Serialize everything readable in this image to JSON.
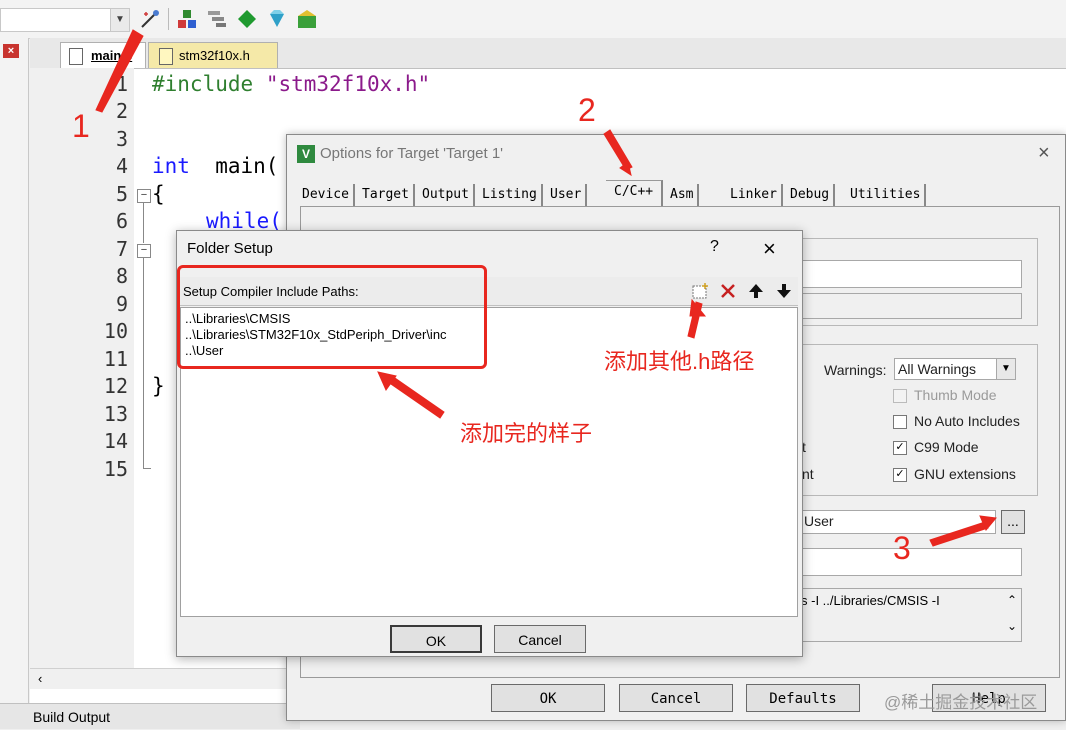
{
  "editor": {
    "tabs": [
      {
        "label": "main.c",
        "active": true
      },
      {
        "label": "stm32f10x.h",
        "active": false
      }
    ],
    "line_numbers": [
      "1",
      "2",
      "3",
      "4",
      "5",
      "6",
      "7",
      "8",
      "9",
      "10",
      "11",
      "12",
      "13",
      "14",
      "15"
    ],
    "code": {
      "line1_directive": "#include",
      "line1_string": "\"stm32f10x.h\"",
      "line4_keyword": "int",
      "line4_rest": "  main(",
      "line5": "{",
      "line6_keyword": "while(",
      "line12": "}"
    },
    "build_output_label": "Build Output",
    "close_glyph": "×"
  },
  "options_dialog": {
    "title": "Options for Target 'Target 1'",
    "tabs": [
      "Device",
      "Target",
      "Output",
      "Listing",
      "User",
      "C/C++",
      "Asm",
      "Linker",
      "Debug",
      "Utilities"
    ],
    "active_tab": "C/C++",
    "warnings_label": "Warnings:",
    "warnings_value": "All Warnings",
    "checkboxes": [
      {
        "label": "Thumb Mode",
        "checked": false,
        "disabled": true
      },
      {
        "label": "No Auto Includes",
        "checked": false,
        "disabled": false
      },
      {
        "label": "C99 Mode",
        "checked": true,
        "disabled": false
      },
      {
        "label": "GNU extensions",
        "checked": true,
        "disabled": false
      }
    ],
    "partial_label_1": "t",
    "partial_label_2": "nt",
    "include_paths_value": "User",
    "browse_button": "...",
    "misc_controls_text": "s -I ../Libraries/CMSIS -I",
    "buttons": {
      "ok": "OK",
      "cancel": "Cancel",
      "defaults": "Defaults",
      "help": "Help"
    }
  },
  "folder_dialog": {
    "title": "Folder Setup",
    "help_glyph": "?",
    "close_glyph": "×",
    "section_label": "Setup Compiler Include Paths:",
    "paths": [
      "..\\Libraries\\CMSIS",
      "..\\Libraries\\STM32F10x_StdPeriph_Driver\\inc",
      "..\\User"
    ],
    "buttons": {
      "ok": "OK",
      "cancel": "Cancel"
    }
  },
  "annotations": {
    "num1": "1",
    "num2": "2",
    "num3": "3",
    "add_other_paths": "添加其他.h路径",
    "after_added": "添加完的样子"
  },
  "watermark": "@稀土掘金技术社区",
  "colors": {
    "annotation_red": "#e8271f",
    "keyword_blue": "#1a1aff",
    "string_purple": "#8b1a8b",
    "directive_green": "#2f7f2f"
  }
}
